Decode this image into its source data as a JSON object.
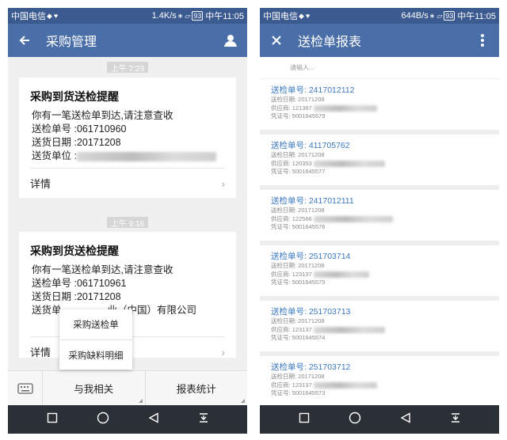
{
  "status": {
    "carrier": "中国电信",
    "left_speed": "1.4K/s",
    "right_speed": "644B/s",
    "battery": "93",
    "time": "中午11:05"
  },
  "left": {
    "title": "采购管理",
    "messages": [
      {
        "time": "上午 7:23",
        "title": "采购到货送检提醒",
        "body": "你有一笔送检单到达,请注意查收",
        "no": "送检单号 :061710960",
        "date": "送货日期 :20171208",
        "unit_label": "送货单位 :",
        "unit_value": "",
        "detail": "详情"
      },
      {
        "time": "上午 9:16",
        "title": "采购到货送检提醒",
        "body": "你有一笔送检单到达,请注意查收",
        "no": "送检单号 :061710961",
        "date": "送货日期 :20171208",
        "unit_label": "送货单",
        "unit_value": "业（中国）有限公司",
        "detail": "详情"
      }
    ],
    "popup": [
      "采购送检单",
      "采购缺料明细"
    ],
    "menu": [
      "与我相关",
      "报表统计"
    ]
  },
  "right": {
    "title": "送检单报表",
    "search_placeholder": "请输入...",
    "items": [
      {
        "no": "送检单号: 2417012112",
        "date": "送检日期: 20171208",
        "supplier": "供应商: 121367",
        "voucher": "凭证号: 5001645579"
      },
      {
        "no": "送检单号: 411705762",
        "date": "送检日期: 20171208",
        "supplier": "供应商: 120353",
        "voucher": "凭证号: 5001645577"
      },
      {
        "no": "送检单号: 2417012111",
        "date": "送检日期: 20171208",
        "supplier": "供应商: 122566",
        "voucher": "凭证号: 5001645576"
      },
      {
        "no": "送检单号: 251703714",
        "date": "送检日期: 20171208",
        "supplier": "供应商: 123137",
        "voucher": "凭证号: 5001645575"
      },
      {
        "no": "送检单号: 251703713",
        "date": "送检日期: 20171208",
        "supplier": "供应商: 123137",
        "voucher": "凭证号: 5001645574"
      },
      {
        "no": "送检单号: 251703712",
        "date": "送检日期: 20171208",
        "supplier": "供应商: 123137",
        "voucher": "凭证号: 5001645573"
      }
    ]
  },
  "icons": {
    "back": "arrow-left-icon",
    "person": "person-icon",
    "close": "close-icon",
    "more": "more-vert-icon",
    "keyboard": "keyboard-icon",
    "nav": [
      "square-icon",
      "circle-icon",
      "triangle-back-icon",
      "notification-down-icon"
    ]
  },
  "colors": {
    "status_bar": "#3b5a8f",
    "app_bar": "#4a6ea8",
    "link_blue": "#3a78c2",
    "nav_bar": "#2b2f36"
  }
}
